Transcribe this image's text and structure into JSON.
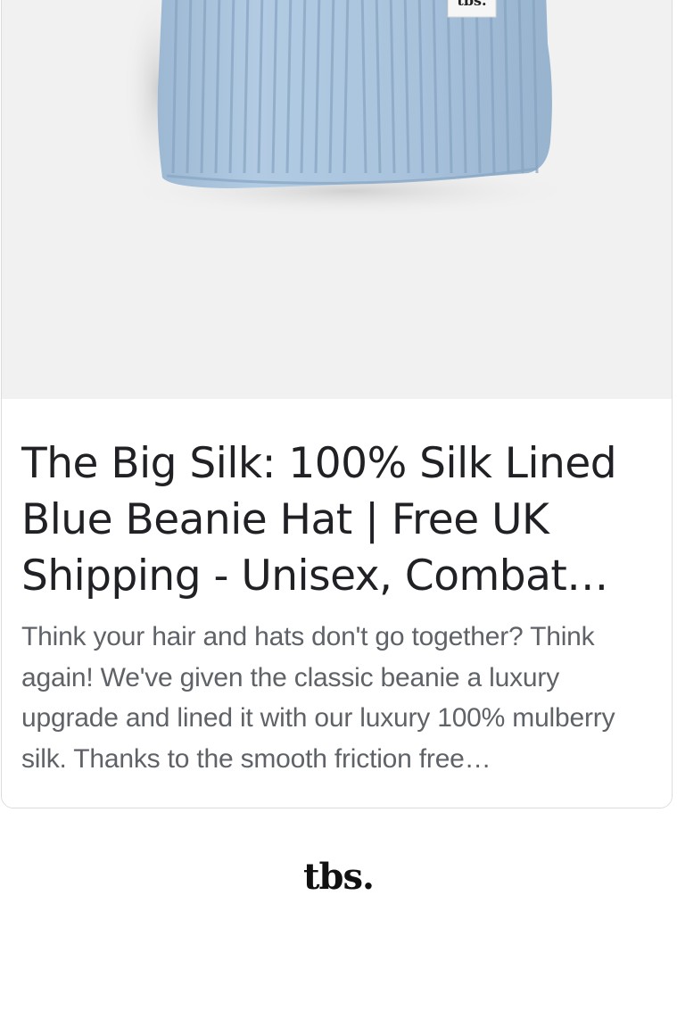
{
  "product_card": {
    "image": {
      "subject": "light blue ribbed knit beanie hat",
      "label_text": "tbs.",
      "background_color": "#f1f1f1",
      "hat_color": "#a9c4df"
    },
    "title": "The Big Silk: 100% Silk Lined Blue Beanie Hat | Free UK Shipping - Unisex, Combat…",
    "description": "Think your hair and hats don't go together? Think again! We've given the classic beanie a luxury upgrade and lined it with our luxury 100% mulberry silk. Thanks to the smooth friction free…"
  },
  "footer": {
    "logo_text": "tbs."
  }
}
